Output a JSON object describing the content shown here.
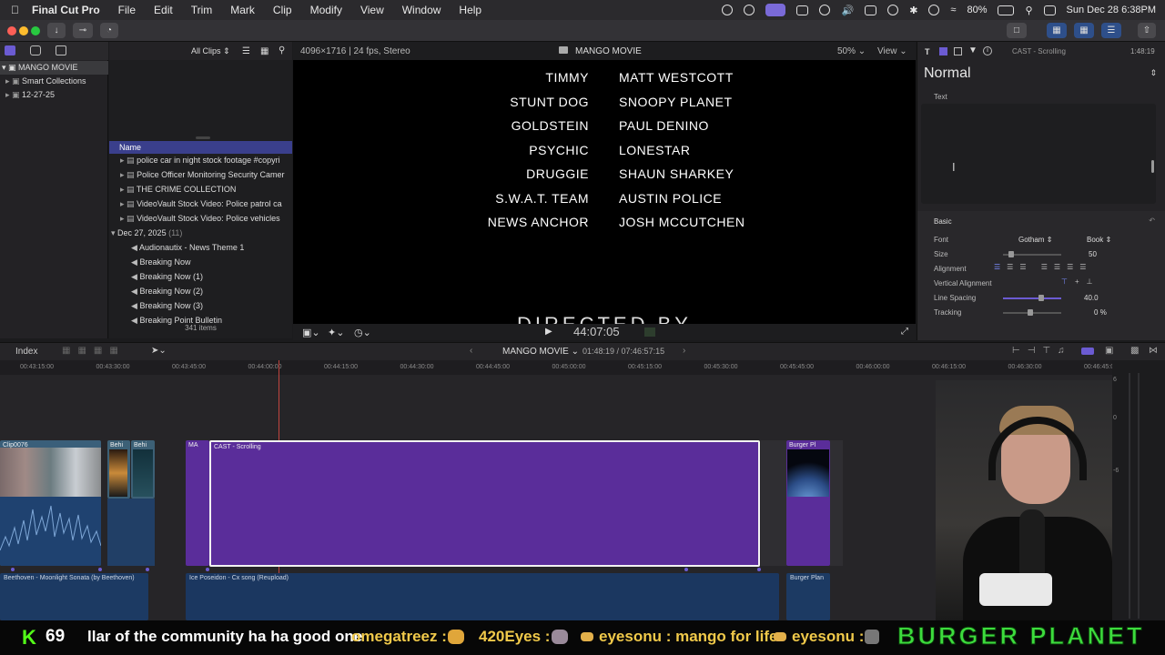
{
  "menubar": {
    "app_name": "Final Cut Pro",
    "items": [
      "File",
      "Edit",
      "Trim",
      "Mark",
      "Clip",
      "Modify",
      "View",
      "Window",
      "Help"
    ],
    "battery": "80%",
    "datetime": "Sun Dec 28  6:38PM"
  },
  "browser": {
    "clips_filter": "All Clips",
    "library": "MANGO MOVIE",
    "sidebar_items": [
      "Smart Collections",
      "12-27-25"
    ],
    "column_name": "Name",
    "rows": [
      "police  car in night stock footage #copyri",
      "Police Officer Monitoring Security Camer",
      "THE CRIME COLLECTION",
      "VideoVault Stock Video:  Police patrol ca",
      "VideoVault Stock Video:  Police vehicles"
    ],
    "group_date": "Dec 27, 2025",
    "group_count": "(11)",
    "audio_rows": [
      "Audionautix - News Theme 1",
      "Breaking Now",
      "Breaking Now (1)",
      "Breaking Now (2)",
      "Breaking Now (3)",
      "Breaking Point Bulletin"
    ],
    "item_count": "341 items"
  },
  "viewer": {
    "format": "4096×1716 | 24 fps, Stereo",
    "project": "MANGO MOVIE",
    "zoom": "50%",
    "view_menu": "View",
    "timecode": "44:07:05",
    "credits": [
      {
        "role": "TIMMY",
        "name": "MATT WESTCOTT"
      },
      {
        "role": "STUNT DOG",
        "name": "SNOOPY PLANET"
      },
      {
        "role": "GOLDSTEIN",
        "name": "PAUL DENINO"
      },
      {
        "role": "PSYCHIC",
        "name": "LONESTAR"
      },
      {
        "role": "DRUGGIE",
        "name": "SHAUN SHARKEY"
      },
      {
        "role": "S.W.A.T. TEAM",
        "name": "AUSTIN POLICE"
      },
      {
        "role": "NEWS ANCHOR",
        "name": "JOSH MCCUTCHEN"
      }
    ],
    "partial_heading": "DIRECTED BY"
  },
  "inspector": {
    "title": "CAST - Scrolling",
    "duration": "1:48:19",
    "preset": "Normal",
    "section_text": "Text",
    "section_basic": "Basic",
    "font_label": "Font",
    "font_value": "Gotham",
    "font_weight": "Book",
    "size_label": "Size",
    "size_value": "50",
    "alignment_label": "Alignment",
    "valign_label": "Vertical Alignment",
    "line_spacing_label": "Line Spacing",
    "line_spacing_value": "40.0",
    "tracking_label": "Tracking",
    "tracking_value": "0",
    "tracking_unit": "%"
  },
  "timeline": {
    "index_label": "Index",
    "project": "MANGO MOVIE",
    "position": "01:48:19 / 07:46:57:15",
    "ruler_ticks": [
      "00:43:15:00",
      "00:43:30:00",
      "00:43:45:00",
      "00:44:00:00",
      "00:44:15:00",
      "00:44:30:00",
      "00:44:45:00",
      "00:45:00:00",
      "00:45:15:00",
      "00:45:30:00",
      "00:45:45:00",
      "00:46:00:00",
      "00:46:15:00",
      "00:46:30:00",
      "00:46:45:00"
    ],
    "clips": [
      "Clip0076",
      "Behi",
      "Behi",
      "MA",
      "CAST - Scrolling",
      "Burger Pl"
    ],
    "audio_clips": [
      "Beethoven - Moonlight Sonata (by Beethoven)",
      "Ice Poseidon - Cx song (Reupload)",
      "Burger Plan"
    ],
    "meter_ticks": [
      "6",
      "0",
      "-6"
    ]
  },
  "chat": {
    "count": "69",
    "segments": [
      {
        "text": "llar of the community ha ha good one",
        "color": "#ffffff"
      },
      {
        "text": "omegatreez :",
        "color": "#f0c94a"
      },
      {
        "text": "420Eyes :",
        "color": "#f0c94a"
      },
      {
        "text": "eyesonu : mango for life",
        "color": "#f0c94a"
      },
      {
        "text": "eyesonu :",
        "color": "#f0c94a"
      }
    ],
    "brand": "BURGER PLANET",
    "brand_color": "#3ddc3d",
    "accent": "#5a2d9a"
  }
}
